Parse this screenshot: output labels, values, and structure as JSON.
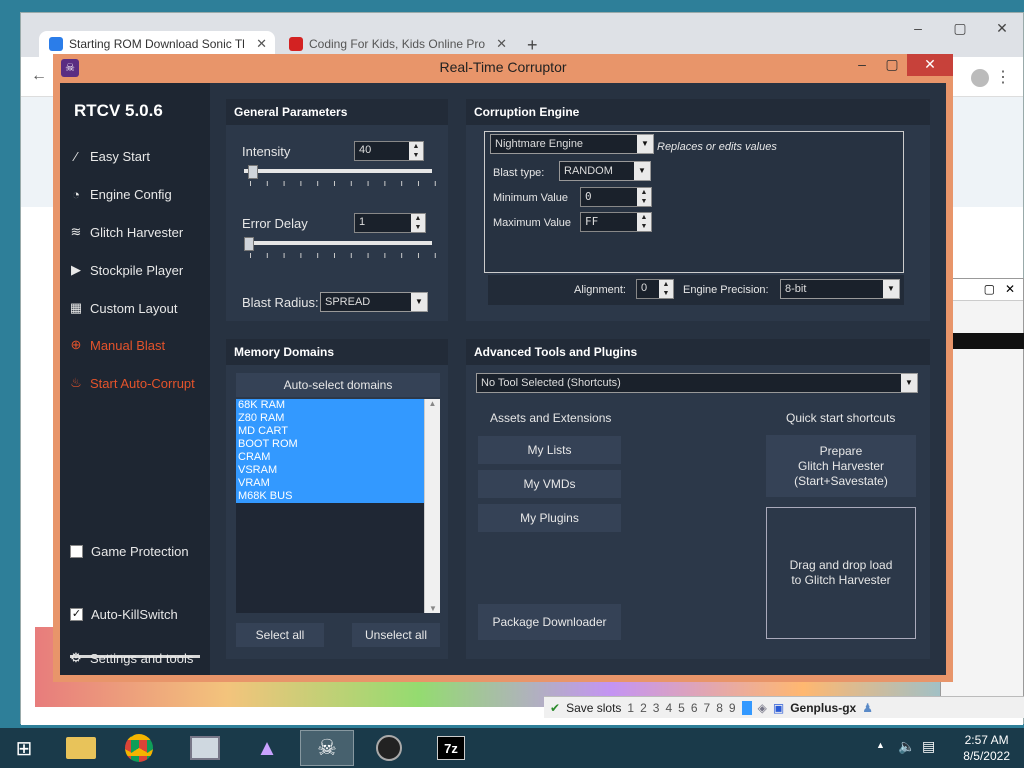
{
  "browser": {
    "tabs": [
      {
        "title": "Starting ROM Download Sonic Tl",
        "active": true
      },
      {
        "title": "Coding For Kids, Kids Online Pro",
        "active": false
      }
    ],
    "new_tab": "+"
  },
  "genplus": {
    "save_slots_label": "Save slots",
    "slots": [
      "1",
      "2",
      "3",
      "4",
      "5",
      "6",
      "7",
      "8",
      "9"
    ],
    "title": "Genplus-gx"
  },
  "rtcv": {
    "window_title": "Real-Time Corruptor",
    "brand": "RTCV 5.0.6",
    "nav": [
      {
        "label": "Easy Start",
        "icon": "wand-icon"
      },
      {
        "label": "Engine Config",
        "icon": "gauge-icon"
      },
      {
        "label": "Glitch Harvester",
        "icon": "layers-icon"
      },
      {
        "label": "Stockpile Player",
        "icon": "play-icon"
      },
      {
        "label": "Custom Layout",
        "icon": "grid-icon"
      },
      {
        "label": "Manual Blast",
        "icon": "crosshair-icon"
      },
      {
        "label": "Start Auto-Corrupt",
        "icon": "fire-icon"
      }
    ],
    "game_protection": "Game Protection",
    "auto_killswitch": "Auto-KillSwitch",
    "settings": "Settings and tools",
    "general": {
      "title": "General Parameters",
      "intensity_label": "Intensity",
      "intensity_value": "40",
      "intensity_fraction": 0.02,
      "error_delay_label": "Error Delay",
      "error_delay_value": "1",
      "error_delay_fraction": 0.0,
      "blast_radius_label": "Blast Radius:",
      "blast_radius_value": "SPREAD"
    },
    "engine": {
      "title": "Corruption Engine",
      "engine_value": "Nightmare Engine",
      "engine_note": "Replaces or edits values",
      "blast_type_label": "Blast type:",
      "blast_type_value": "RANDOM",
      "min_label": "Minimum Value",
      "min_value": "0",
      "max_label": "Maximum Value",
      "max_value": "FF",
      "alignment_label": "Alignment:",
      "alignment_value": "0",
      "precision_label": "Engine Precision:",
      "precision_value": "8-bit"
    },
    "memory": {
      "title": "Memory Domains",
      "auto_select": "Auto-select domains",
      "domains": [
        "68K RAM",
        "Z80 RAM",
        "MD CART",
        "BOOT ROM",
        "CRAM",
        "VSRAM",
        "VRAM",
        "M68K BUS"
      ],
      "select_all": "Select all",
      "unselect_all": "Unselect all"
    },
    "tools": {
      "title": "Advanced Tools and Plugins",
      "tool_select": "No Tool Selected (Shortcuts)",
      "assets_title": "Assets and Extensions",
      "my_lists": "My Lists",
      "my_vmds": "My VMDs",
      "my_plugins": "My Plugins",
      "package_downloader": "Package Downloader",
      "quick_title": "Quick start shortcuts",
      "prepare_line1": "Prepare",
      "prepare_line2": "Glitch Harvester",
      "prepare_line3": "(Start+Savestate)",
      "drop_line1": "Drag and drop load",
      "drop_line2": "to Glitch Harvester"
    }
  },
  "taskbar": {
    "time": "2:57 AM",
    "date": "8/5/2022"
  }
}
